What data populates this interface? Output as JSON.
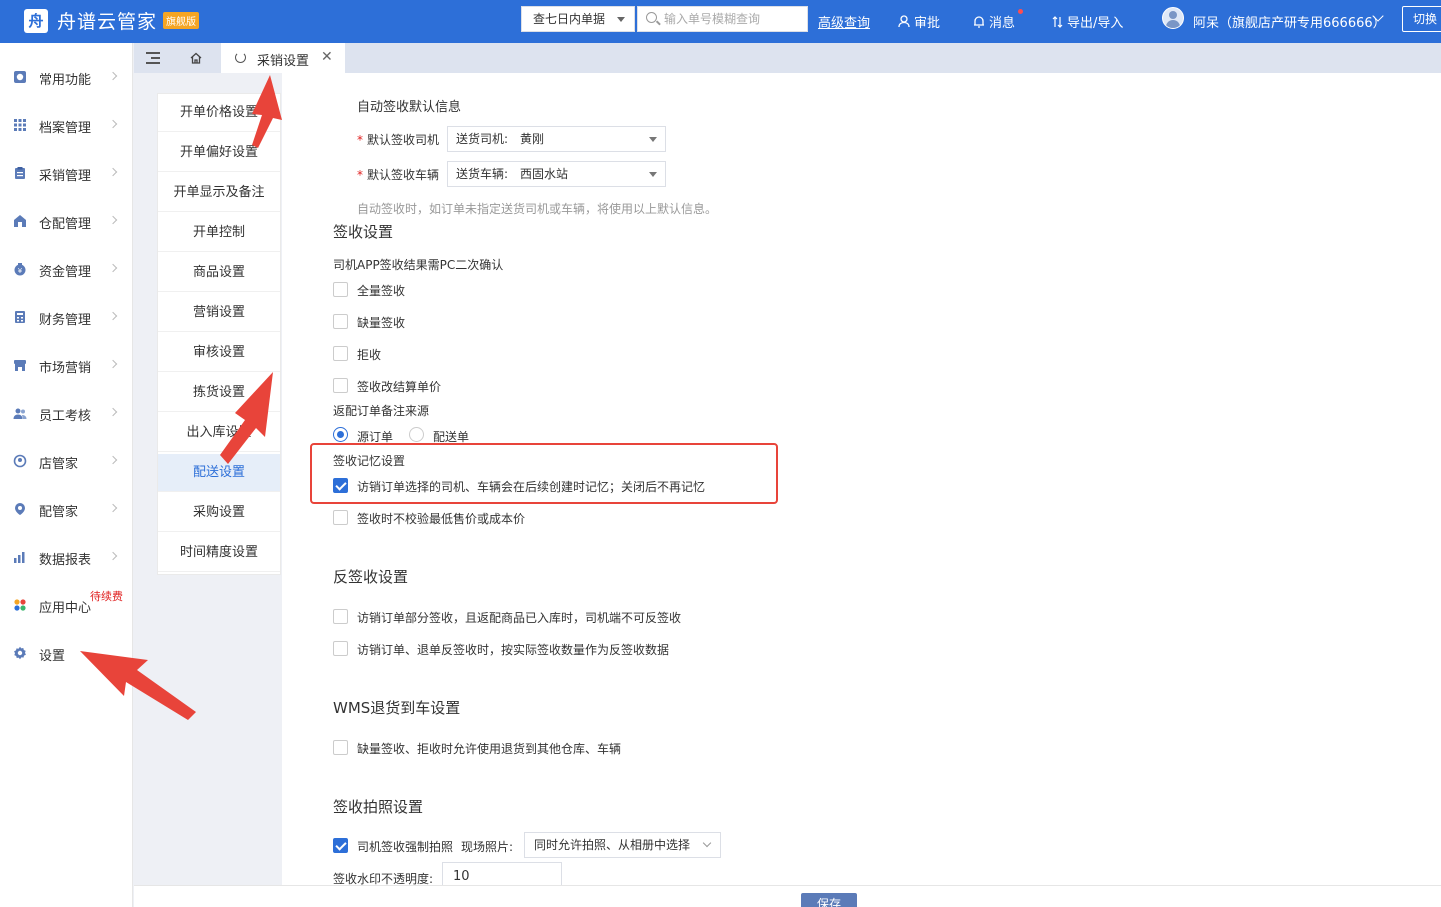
{
  "app": {
    "logo_glyph": "舟",
    "name": "舟谱云管家",
    "edition_badge": "旗舰版"
  },
  "header": {
    "range_select": "查七日内单据",
    "search_placeholder": "输入单号模糊查询",
    "advanced_query": "高级查询",
    "approval": "审批",
    "messages": "消息",
    "import_export": "导出/导入",
    "user": "阿呆（旗舰店产研专用666666）",
    "switch": "切换"
  },
  "sidebar": {
    "items": [
      {
        "label": "常用功能",
        "icon": "clock-icon"
      },
      {
        "label": "档案管理",
        "icon": "grid-icon"
      },
      {
        "label": "采销管理",
        "icon": "clipboard-icon"
      },
      {
        "label": "仓配管理",
        "icon": "warehouse-icon"
      },
      {
        "label": "资金管理",
        "icon": "money-bag-icon"
      },
      {
        "label": "财务管理",
        "icon": "calculator-icon"
      },
      {
        "label": "市场营销",
        "icon": "store-icon"
      },
      {
        "label": "员工考核",
        "icon": "people-icon"
      },
      {
        "label": "店管家",
        "icon": "shop-assistant-icon"
      },
      {
        "label": "配管家",
        "icon": "delivery-assistant-icon"
      },
      {
        "label": "数据报表",
        "icon": "bar-chart-icon"
      },
      {
        "label": "应用中心",
        "icon": "apps-icon"
      },
      {
        "label": "设置",
        "icon": "gear-icon"
      }
    ],
    "renew_badge": "待续费"
  },
  "tabs": {
    "active_label": "采销设置",
    "close_glyph": "✕"
  },
  "submenu": {
    "items": [
      "开单价格设置",
      "开单偏好设置",
      "开单显示及备注",
      "开单控制",
      "商品设置",
      "营销设置",
      "审核设置",
      "拣货设置",
      "出入库设置",
      "配送设置",
      "采购设置",
      "时间精度设置"
    ],
    "active_index": 9
  },
  "content": {
    "auto_sign_title": "自动签收默认信息",
    "default_driver_label": "默认签收司机",
    "default_driver_value": "送货司机:　黄刚",
    "default_vehicle_label": "默认签收车辆",
    "default_vehicle_value": "送货车辆:　西固水站",
    "auto_sign_hint": "自动签收时，如订单未指定送货司机或车辆，将使用以上默认信息。",
    "sign_section": "签收设置",
    "driver_app_confirm": "司机APP签收结果需PC二次确认",
    "opt_full_sign": "全量签收",
    "opt_short_sign": "缺量签收",
    "opt_reject": "拒收",
    "opt_change_price": "签收改结算单价",
    "remark_source_title": "返配订单备注来源",
    "radio_source_order": "源订单",
    "radio_delivery_order": "配送单",
    "memory_title": "签收记忆设置",
    "memory_option": "访销订单选择的司机、车辆会在后续创建时记忆；关闭后不再记忆",
    "skip_price_check": "签收时不校验最低售价或成本价",
    "reverse_section": "反签收设置",
    "reverse_opt1": "访销订单部分签收，且返配商品已入库时，司机端不可反签收",
    "reverse_opt2": "访销订单、退单反签收时，按实际签收数量作为反签收数据",
    "wms_section": "WMS退货到车设置",
    "wms_opt1": "缺量签收、拒收时允许使用退货到其他仓库、车辆",
    "photo_section": "签收拍照设置",
    "photo_force": "司机签收强制拍照",
    "photo_source_label": "现场照片:",
    "photo_source_value": "同时允许拍照、从相册中选择",
    "watermark_label": "签收水印不透明度:",
    "watermark_value": "10",
    "save": "保存"
  },
  "colors": {
    "primary": "#2d6fd8",
    "annotation": "#e8443a",
    "required": "#e02020"
  }
}
